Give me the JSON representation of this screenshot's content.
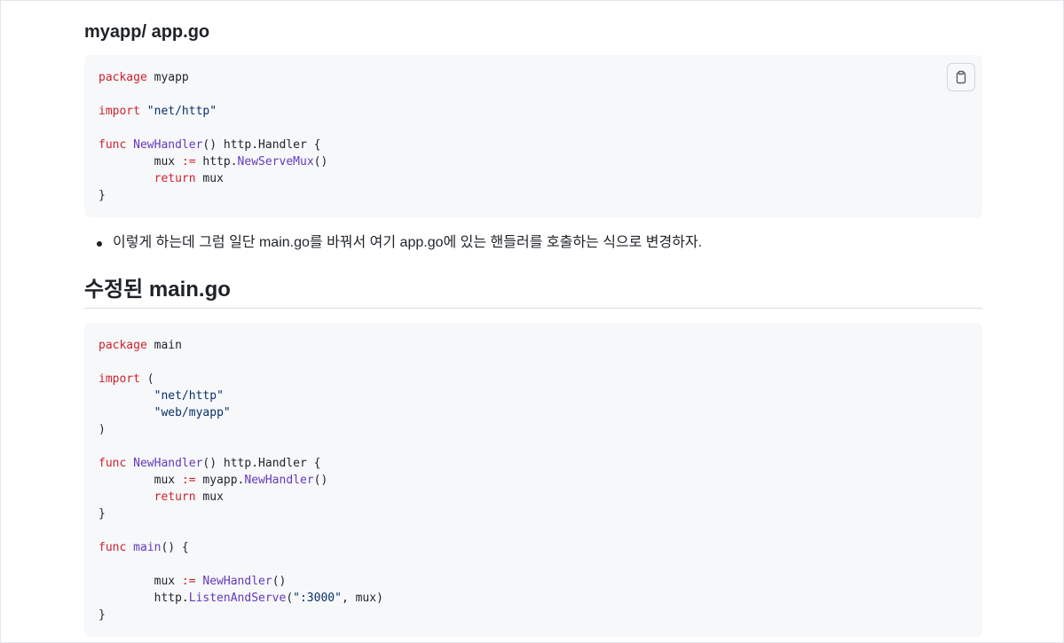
{
  "section1": {
    "heading": "myapp/ app.go",
    "copy_icon": "clipboard-icon",
    "code_lines": [
      [
        {
          "t": "package",
          "c": "kw"
        },
        {
          "t": " myapp",
          "c": ""
        }
      ],
      [],
      [
        {
          "t": "import",
          "c": "kw"
        },
        {
          "t": " ",
          "c": ""
        },
        {
          "t": "\"net/http\"",
          "c": "str"
        }
      ],
      [],
      [
        {
          "t": "func",
          "c": "kw"
        },
        {
          "t": " ",
          "c": ""
        },
        {
          "t": "NewHandler",
          "c": "fn"
        },
        {
          "t": "() http.Handler {",
          "c": ""
        }
      ],
      [
        {
          "t": "        mux ",
          "c": ""
        },
        {
          "t": ":=",
          "c": "kw"
        },
        {
          "t": " http.",
          "c": ""
        },
        {
          "t": "NewServeMux",
          "c": "fn"
        },
        {
          "t": "()",
          "c": ""
        }
      ],
      [
        {
          "t": "        ",
          "c": ""
        },
        {
          "t": "return",
          "c": "kw"
        },
        {
          "t": " mux",
          "c": ""
        }
      ],
      [
        {
          "t": "}",
          "c": ""
        }
      ]
    ]
  },
  "bullets": [
    "이렇게 하는데 그럼 일단 main.go를 바꿔서 여기 app.go에 있는 핸들러를 호출하는 식으로 변경하자."
  ],
  "section2": {
    "heading": "수정된 main.go",
    "code_lines": [
      [
        {
          "t": "package",
          "c": "kw"
        },
        {
          "t": " main",
          "c": ""
        }
      ],
      [],
      [
        {
          "t": "import",
          "c": "kw"
        },
        {
          "t": " (",
          "c": ""
        }
      ],
      [
        {
          "t": "        ",
          "c": ""
        },
        {
          "t": "\"net/http\"",
          "c": "str"
        }
      ],
      [
        {
          "t": "        ",
          "c": ""
        },
        {
          "t": "\"web/myapp\"",
          "c": "str"
        }
      ],
      [
        {
          "t": ")",
          "c": ""
        }
      ],
      [],
      [
        {
          "t": "func",
          "c": "kw"
        },
        {
          "t": " ",
          "c": ""
        },
        {
          "t": "NewHandler",
          "c": "fn"
        },
        {
          "t": "() http.Handler {",
          "c": ""
        }
      ],
      [
        {
          "t": "        mux ",
          "c": ""
        },
        {
          "t": ":=",
          "c": "kw"
        },
        {
          "t": " myapp.",
          "c": ""
        },
        {
          "t": "NewHandler",
          "c": "fn"
        },
        {
          "t": "()",
          "c": ""
        }
      ],
      [
        {
          "t": "        ",
          "c": ""
        },
        {
          "t": "return",
          "c": "kw"
        },
        {
          "t": " mux",
          "c": ""
        }
      ],
      [
        {
          "t": "}",
          "c": ""
        }
      ],
      [],
      [
        {
          "t": "func",
          "c": "kw"
        },
        {
          "t": " ",
          "c": ""
        },
        {
          "t": "main",
          "c": "fn"
        },
        {
          "t": "() {",
          "c": ""
        }
      ],
      [],
      [
        {
          "t": "        mux ",
          "c": ""
        },
        {
          "t": ":=",
          "c": "kw"
        },
        {
          "t": " ",
          "c": ""
        },
        {
          "t": "NewHandler",
          "c": "fn"
        },
        {
          "t": "()",
          "c": ""
        }
      ],
      [
        {
          "t": "        http.",
          "c": ""
        },
        {
          "t": "ListenAndServe",
          "c": "fn"
        },
        {
          "t": "(",
          "c": ""
        },
        {
          "t": "\":3000\"",
          "c": "str"
        },
        {
          "t": ", mux)",
          "c": ""
        }
      ],
      [
        {
          "t": "}",
          "c": ""
        }
      ]
    ]
  },
  "colors": {
    "keyword": "#cf222e",
    "function": "#6639ba",
    "string": "#0a3069",
    "code_background": "#f6f8fa",
    "text": "#1f2328"
  }
}
